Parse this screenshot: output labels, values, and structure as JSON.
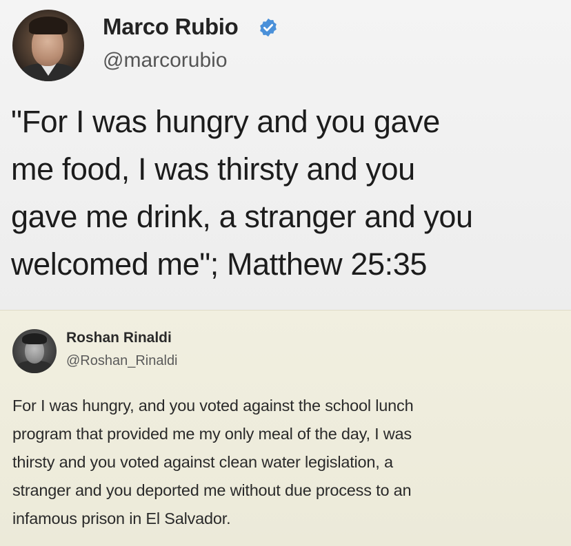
{
  "main_tweet": {
    "author_name": "Marco Rubio",
    "handle": "@marcorubio",
    "verified": true,
    "text_lines": [
      "\"For I was hungry and you gave",
      "me food, I was thirsty and you",
      "gave me drink, a stranger and you",
      "welcomed me\"; Matthew 25:35"
    ]
  },
  "reply_tweet": {
    "author_name": "Roshan Rinaldi",
    "handle": "@Roshan_Rinaldi",
    "text_lines": [
      "For I was hungry, and you voted against the school lunch",
      "program that provided me my only meal of the day, I was",
      "thirsty and you voted against clean water legislation, a",
      "stranger and you deported me without due process to an",
      "infamous prison in El Salvador."
    ]
  },
  "colors": {
    "verified_badge": "#4a90d9",
    "reply_background": "#efedde"
  },
  "icons": {
    "verified": "verified-badge-icon"
  }
}
